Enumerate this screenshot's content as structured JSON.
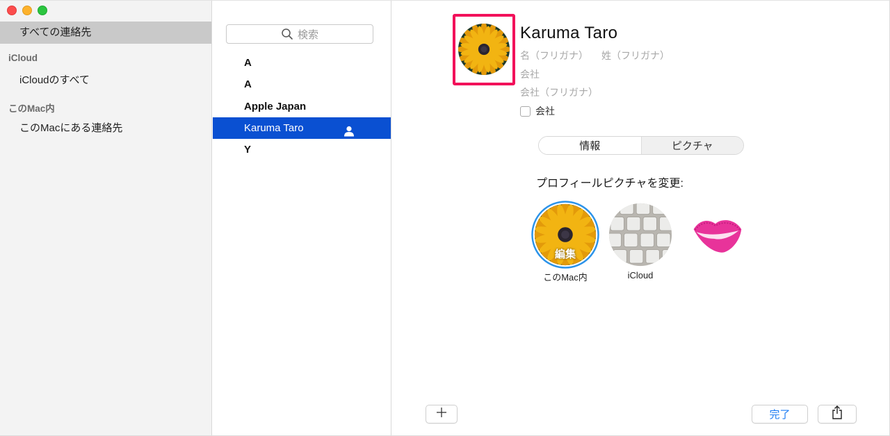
{
  "window": {
    "traffic_lights": [
      "close",
      "minimize",
      "maximize"
    ]
  },
  "sidebar": {
    "all_contacts": "すべての連絡先",
    "sections": [
      {
        "header": "iCloud",
        "items": [
          {
            "label": "iCloudのすべて"
          }
        ]
      },
      {
        "header": "このMac内",
        "items": [
          {
            "label": "このMacにある連絡先"
          }
        ]
      }
    ],
    "selected": "すべての連絡先"
  },
  "contact_list": {
    "search_placeholder": "検索",
    "search_icon": "magnifier-icon",
    "rows": [
      {
        "label": "A"
      },
      {
        "label": "A"
      },
      {
        "label": "Apple Japan"
      },
      {
        "label": "Karuma Taro",
        "selected": true,
        "icon": "me-card-person-icon"
      },
      {
        "label": "Y"
      }
    ]
  },
  "detail": {
    "name": "Karuma  Taro",
    "fields": {
      "first_phonetic": "名（フリガナ）",
      "last_phonetic": "姓（フリガナ）",
      "company": "会社",
      "company_phonetic": "会社（フリガナ）"
    },
    "company_checkbox": {
      "label": "会社",
      "checked": false
    },
    "avatar": {
      "image": "sunflower",
      "highlight_color": "#f2115a"
    },
    "tabs": [
      {
        "label": "情報",
        "selected": false
      },
      {
        "label": "ピクチャ",
        "selected": true
      }
    ],
    "profile_picture_label": "プロフィールピクチャを変更:",
    "pictures": [
      {
        "image": "sunflower",
        "caption": "このMac内",
        "overlay": "編集",
        "selected": true
      },
      {
        "image": "keyboard",
        "caption": "iCloud"
      },
      {
        "image": "lips",
        "caption": ""
      }
    ]
  },
  "toolbar": {
    "add_icon": "plus-icon",
    "done_label": "完了",
    "share_icon": "share-icon"
  },
  "colors": {
    "selection": "#0a50d2",
    "accent": "#1c7cf3",
    "highlight": "#f2115a"
  }
}
